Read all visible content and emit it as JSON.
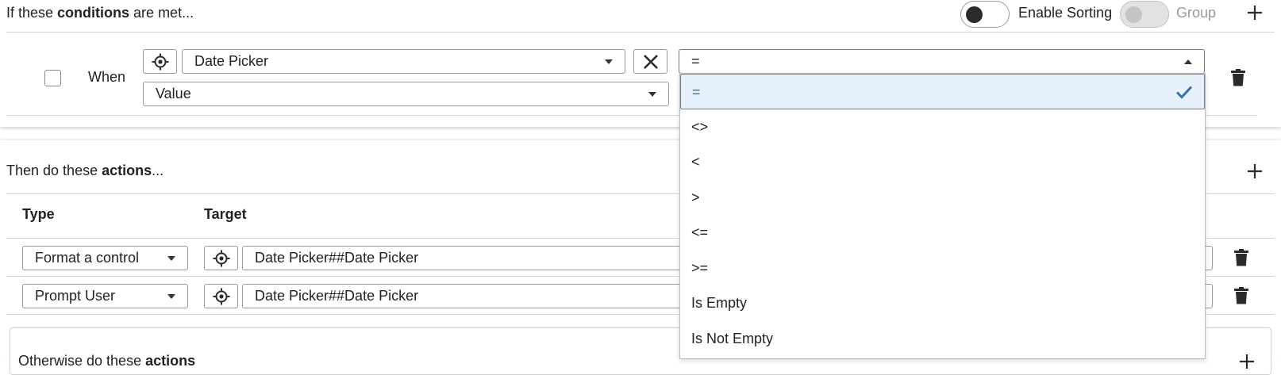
{
  "conditions": {
    "heading_pre": "If these ",
    "heading_bold": "conditions",
    "heading_post": " are met...",
    "enable_sorting_label": "Enable Sorting",
    "group_label": "Group",
    "add_icon": "plus-icon",
    "row": {
      "when_label": "When",
      "source_value": "Date Picker",
      "source_icon": "target-icon",
      "clear_icon": "close-icon",
      "property_value": "Value",
      "operator_value": "=",
      "delete_icon": "trash-icon"
    }
  },
  "operator_menu": {
    "options": [
      "=",
      "<>",
      "<",
      ">",
      "<=",
      ">=",
      "Is Empty",
      "Is Not Empty"
    ],
    "selected_index": 0,
    "check_icon": "checkmark-icon"
  },
  "actions": {
    "heading_pre": "Then do these ",
    "heading_bold": "actions",
    "heading_post": "...",
    "add_icon": "plus-icon",
    "columns": {
      "type": "Type",
      "target": "Target"
    },
    "rows": [
      {
        "type": "Format a control",
        "target": "Date Picker##Date Picker"
      },
      {
        "type": "Prompt User",
        "target": "Date Picker##Date Picker"
      }
    ]
  },
  "otherwise": {
    "heading_pre": "Otherwise do these ",
    "heading_bold": "actions",
    "add_icon": "plus-icon"
  },
  "colors": {
    "accent": "#3a6ea8",
    "selected_bg": "#e7f1fb",
    "border": "#999999"
  }
}
